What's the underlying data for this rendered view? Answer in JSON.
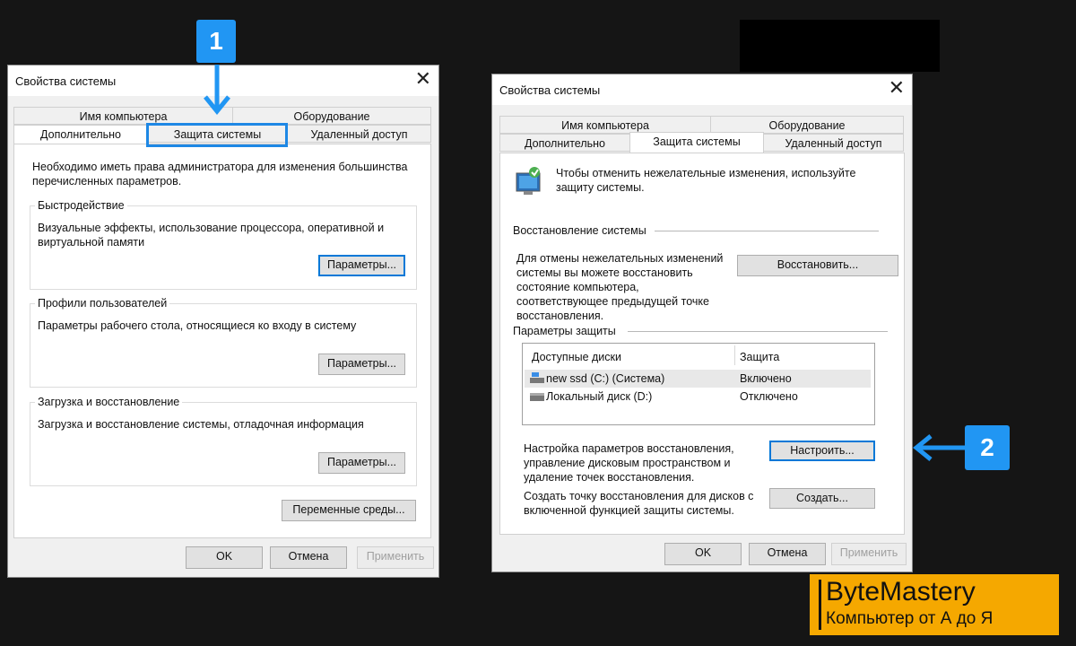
{
  "left_dialog": {
    "title": "Свойства системы",
    "tabs_row1": [
      "Имя компьютера",
      "Оборудование"
    ],
    "tabs_row2": [
      "Дополнительно",
      "Защита системы",
      "Удаленный доступ"
    ],
    "intro": "Необходимо иметь права администратора для изменения большинства перечисленных параметров.",
    "groups": [
      {
        "label": "Быстродействие",
        "text": "Визуальные эффекты, использование процессора, оперативной и виртуальной памяти",
        "button": "Параметры..."
      },
      {
        "label": "Профили пользователей",
        "text": "Параметры рабочего стола, относящиеся ко входу в систему",
        "button": "Параметры..."
      },
      {
        "label": "Загрузка и восстановление",
        "text": "Загрузка и восстановление системы, отладочная информация",
        "button": "Параметры..."
      }
    ],
    "env_button": "Переменные среды...",
    "ok": "OK",
    "cancel": "Отмена",
    "apply": "Применить"
  },
  "right_dialog": {
    "title": "Свойства системы",
    "tabs_row1": [
      "Имя компьютера",
      "Оборудование"
    ],
    "tabs_row2": [
      "Дополнительно",
      "Защита системы",
      "Удаленный доступ"
    ],
    "intro": "Чтобы отменить нежелательные изменения, используйте защиту системы.",
    "restore_section": "Восстановление системы",
    "restore_text": "Для отмены нежелательных изменений системы вы можете восстановить состояние компьютера, соответствующее предыдущей точке восстановления.",
    "restore_button": "Восстановить...",
    "protection_section": "Параметры защиты",
    "table_headers": [
      "Доступные диски",
      "Защита"
    ],
    "drives": [
      {
        "name": "new ssd (C:) (Система)",
        "status": "Включено"
      },
      {
        "name": "Локальный диск (D:)",
        "status": "Отключено"
      }
    ],
    "configure_text": "Настройка параметров восстановления, управление дисковым пространством и удаление точек восстановления.",
    "configure_button": "Настроить...",
    "create_text": "Создать точку восстановления для дисков с включенной функцией защиты системы.",
    "create_button": "Создать...",
    "ok": "OK",
    "cancel": "Отмена",
    "apply": "Применить"
  },
  "badges": {
    "step1": "1",
    "step2": "2"
  },
  "brand": {
    "name": "ByteMastery",
    "tagline": "Компьютер от А до Я"
  },
  "colors": {
    "accent": "#2196f3",
    "brand_bg": "#f5a800",
    "background": "#151515"
  }
}
